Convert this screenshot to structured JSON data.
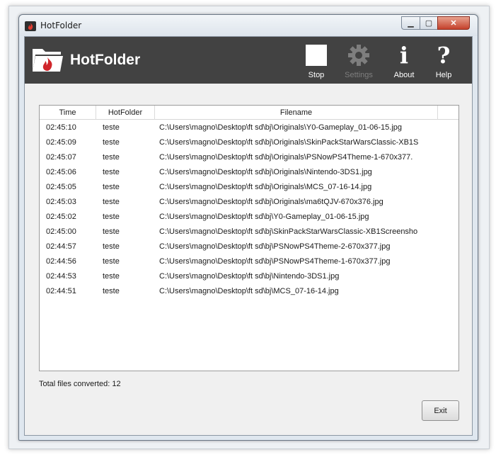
{
  "window": {
    "title": "HotFolder",
    "controls": {
      "minimize": "▁",
      "maximize": "▢",
      "close": "✕"
    }
  },
  "header": {
    "app_title": "HotFolder",
    "logo_icon": "folder-flame-icon",
    "toolbar": [
      {
        "label": "Stop",
        "icon": "stop-square-icon",
        "enabled": true
      },
      {
        "label": "Settings",
        "icon": "gear-icon",
        "enabled": false
      },
      {
        "label": "About",
        "icon": "info-icon",
        "enabled": true
      },
      {
        "label": "Help",
        "icon": "question-icon",
        "enabled": true
      }
    ]
  },
  "grid": {
    "columns": [
      "Time",
      "HotFolder",
      "Filename"
    ],
    "rows": [
      {
        "time": "02:45:10",
        "hotfolder": "teste",
        "filename": "C:\\Users\\magno\\Desktop\\ft sd\\bj\\Originals\\Y0-Gameplay_01-06-15.jpg"
      },
      {
        "time": "02:45:09",
        "hotfolder": "teste",
        "filename": "C:\\Users\\magno\\Desktop\\ft sd\\bj\\Originals\\SkinPackStarWarsClassic-XB1S"
      },
      {
        "time": "02:45:07",
        "hotfolder": "teste",
        "filename": "C:\\Users\\magno\\Desktop\\ft sd\\bj\\Originals\\PSNowPS4Theme-1-670x377."
      },
      {
        "time": "02:45:06",
        "hotfolder": "teste",
        "filename": "C:\\Users\\magno\\Desktop\\ft sd\\bj\\Originals\\Nintendo-3DS1.jpg"
      },
      {
        "time": "02:45:05",
        "hotfolder": "teste",
        "filename": "C:\\Users\\magno\\Desktop\\ft sd\\bj\\Originals\\MCS_07-16-14.jpg"
      },
      {
        "time": "02:45:03",
        "hotfolder": "teste",
        "filename": "C:\\Users\\magno\\Desktop\\ft sd\\bj\\Originals\\ma6tQJV-670x376.jpg"
      },
      {
        "time": "02:45:02",
        "hotfolder": "teste",
        "filename": "C:\\Users\\magno\\Desktop\\ft sd\\bj\\Y0-Gameplay_01-06-15.jpg"
      },
      {
        "time": "02:45:00",
        "hotfolder": "teste",
        "filename": "C:\\Users\\magno\\Desktop\\ft sd\\bj\\SkinPackStarWarsClassic-XB1Screensho"
      },
      {
        "time": "02:44:57",
        "hotfolder": "teste",
        "filename": "C:\\Users\\magno\\Desktop\\ft sd\\bj\\PSNowPS4Theme-2-670x377.jpg"
      },
      {
        "time": "02:44:56",
        "hotfolder": "teste",
        "filename": "C:\\Users\\magno\\Desktop\\ft sd\\bj\\PSNowPS4Theme-1-670x377.jpg"
      },
      {
        "time": "02:44:53",
        "hotfolder": "teste",
        "filename": "C:\\Users\\magno\\Desktop\\ft sd\\bj\\Nintendo-3DS1.jpg"
      },
      {
        "time": "02:44:51",
        "hotfolder": "teste",
        "filename": "C:\\Users\\magno\\Desktop\\ft sd\\bj\\MCS_07-16-14.jpg"
      }
    ]
  },
  "footer": {
    "total_label": "Total files converted: 12",
    "exit_label": "Exit"
  },
  "colors": {
    "header_bg": "#424242",
    "flame": "#d0262b",
    "disabled_text": "#7e7e7e"
  }
}
